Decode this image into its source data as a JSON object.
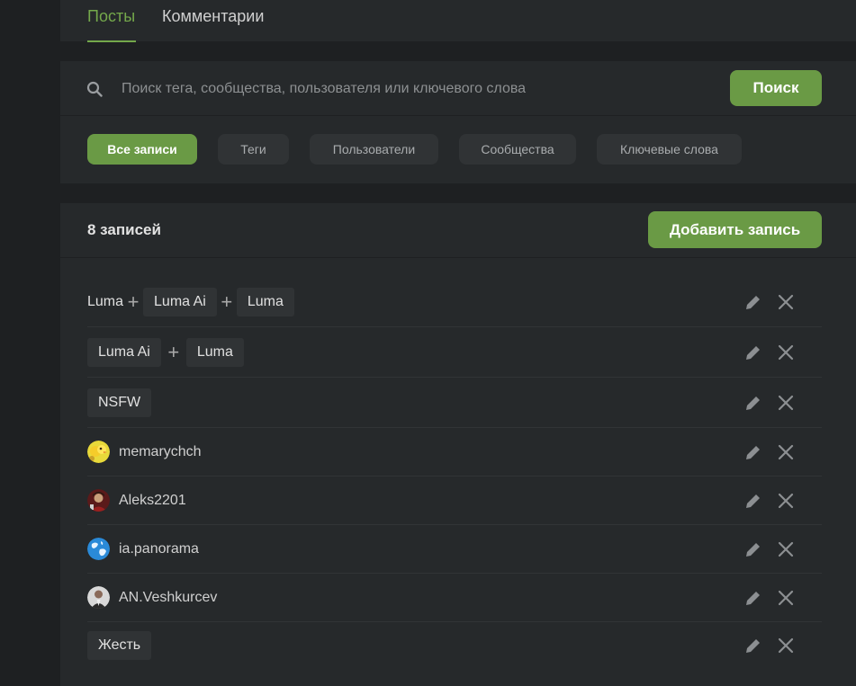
{
  "tabs": [
    {
      "label": "Посты",
      "active": true
    },
    {
      "label": "Комментарии",
      "active": false
    }
  ],
  "search": {
    "placeholder": "Поиск тега, сообщества, пользователя или ключевого слова",
    "value": "",
    "button_label": "Поиск",
    "icon": "search-icon"
  },
  "filters": [
    {
      "label": "Все записи",
      "active": true
    },
    {
      "label": "Теги",
      "active": false
    },
    {
      "label": "Пользователи",
      "active": false
    },
    {
      "label": "Сообщества",
      "active": false
    },
    {
      "label": "Ключевые слова",
      "active": false
    }
  ],
  "list": {
    "count_label": "8 записей",
    "add_button_label": "Добавить запись",
    "rows": [
      {
        "type": "tags",
        "parts": [
          {
            "text": "Luma",
            "style": "plain"
          },
          {
            "text": "Luma Ai",
            "style": "tag"
          },
          {
            "text": "Luma",
            "style": "tag"
          }
        ]
      },
      {
        "type": "tags",
        "parts": [
          {
            "text": "Luma Ai",
            "style": "tag"
          },
          {
            "text": "Luma",
            "style": "tag"
          }
        ]
      },
      {
        "type": "tags",
        "parts": [
          {
            "text": "NSFW",
            "style": "tag"
          }
        ]
      },
      {
        "type": "user",
        "name": "memarychch",
        "avatar": "avatar-yellow-chick"
      },
      {
        "type": "user",
        "name": "Aleks2201",
        "avatar": "avatar-red-figure"
      },
      {
        "type": "user",
        "name": "ia.panorama",
        "avatar": "avatar-globe"
      },
      {
        "type": "user",
        "name": "AN.Veshkurcev",
        "avatar": "avatar-person-photo"
      },
      {
        "type": "tags",
        "parts": [
          {
            "text": "Жесть",
            "style": "tag"
          }
        ]
      }
    ],
    "row_actions": [
      "pencil-icon",
      "close-icon"
    ],
    "plus_icon": "plus-icon"
  },
  "colors": {
    "background": "#1e2022",
    "panel": "#26292b",
    "accent": "#6a9a45",
    "accent_text": "#74a84b",
    "chip_inactive": "#303335"
  }
}
